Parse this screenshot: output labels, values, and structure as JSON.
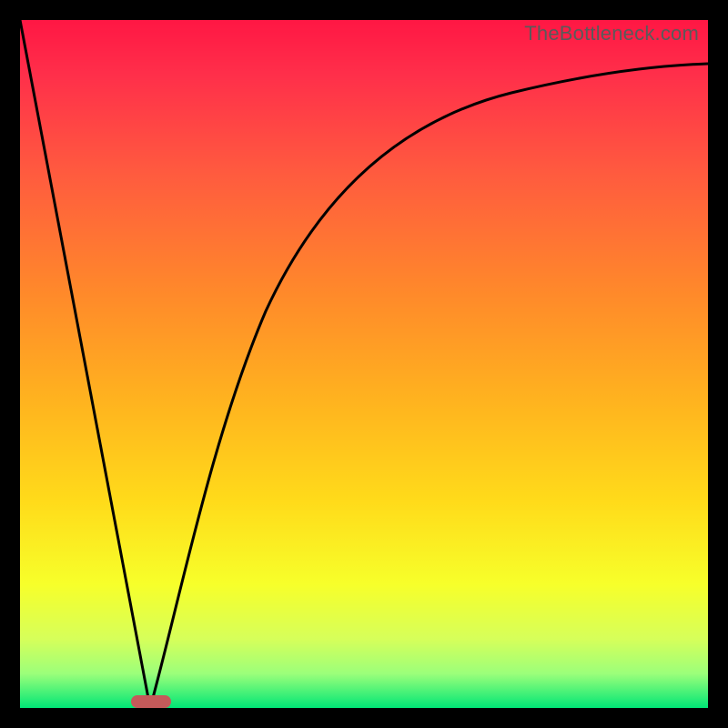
{
  "watermark": "TheBottleneck.com",
  "chart_data": {
    "type": "line",
    "title": "",
    "xlabel": "",
    "ylabel": "",
    "xlim": [
      0,
      100
    ],
    "ylim": [
      0,
      100
    ],
    "grid": false,
    "legend": false,
    "gradient_background": {
      "top_color": "#ff1744",
      "mid_colors": [
        "#ff8a2a",
        "#ffdb1a",
        "#f7ff2a"
      ],
      "bottom_color": "#00e676",
      "orientation": "vertical"
    },
    "series": [
      {
        "name": "left-line",
        "type": "line",
        "color": "#000000",
        "x": [
          0,
          19
        ],
        "y": [
          100,
          0
        ]
      },
      {
        "name": "right-curve",
        "type": "line",
        "color": "#000000",
        "x": [
          19,
          22,
          26,
          30,
          35,
          40,
          46,
          53,
          62,
          73,
          86,
          100
        ],
        "y": [
          0,
          10,
          22,
          33,
          44,
          53,
          62,
          70,
          77,
          83,
          88,
          92
        ]
      }
    ],
    "marker": {
      "name": "optimal-region",
      "shape": "pill",
      "color": "#c45a5a",
      "x_center": 19,
      "y": 0,
      "width_pct": 5
    }
  }
}
